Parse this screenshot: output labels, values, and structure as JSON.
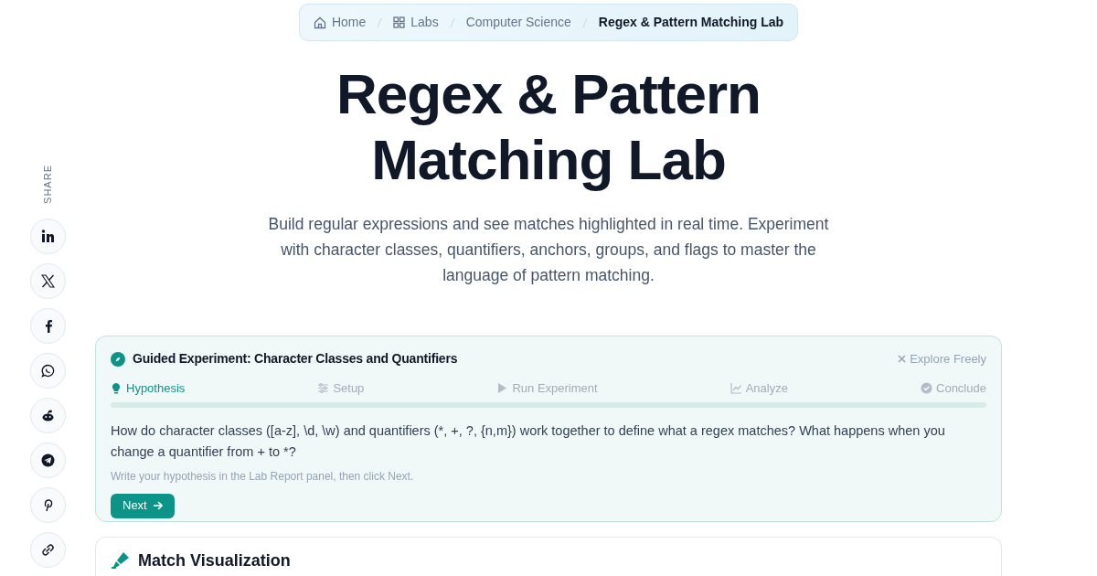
{
  "breadcrumb": [
    {
      "label": "Home",
      "current": false
    },
    {
      "label": "Labs",
      "current": false
    },
    {
      "label": "Computer Science",
      "current": false
    },
    {
      "label": "Regex & Pattern Matching Lab",
      "current": true
    }
  ],
  "title": [
    "Regex & Pattern",
    "Matching Lab"
  ],
  "description": "Build regular expressions and see matches highlighted in real time. Experiment with character classes, quantifiers, anchors, groups, and flags to master the language of pattern matching.",
  "share": {
    "label": "SHARE",
    "networks": [
      {
        "kind": "linkedin"
      },
      {
        "kind": "x"
      },
      {
        "kind": "facebook"
      },
      {
        "kind": "whatsapp"
      },
      {
        "kind": "reddit"
      },
      {
        "kind": "telegram"
      },
      {
        "kind": "pinterest"
      },
      {
        "kind": "link"
      }
    ]
  },
  "experiment": {
    "title": "Guided Experiment: Character Classes and Quantifiers",
    "dismiss": "Explore Freely",
    "steps": [
      {
        "label": "Hypothesis",
        "kind": "bulb",
        "selected": true
      },
      {
        "label": "Setup",
        "kind": "sliders",
        "selected": false
      },
      {
        "label": "Run Experiment",
        "kind": "play",
        "selected": false
      },
      {
        "label": "Analyze",
        "kind": "chart",
        "selected": false
      },
      {
        "label": "Conclude",
        "kind": "check",
        "selected": false
      }
    ],
    "question": "How do character classes ([a-z], \\d, \\w) and quantifiers (*, +, ?, {n,m}) work together to define what a regex matches? What happens when you change a quantifier from + to *?",
    "hint": "Write your hypothesis in the Lab Report panel, then click Next.",
    "button": "Next"
  },
  "section": {
    "title": "Match Visualization"
  }
}
